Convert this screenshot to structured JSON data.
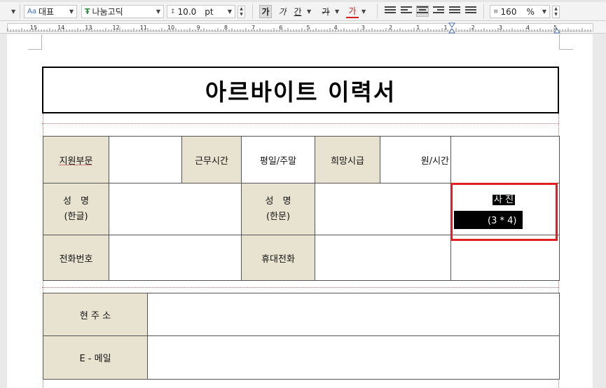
{
  "toolbar": {
    "style": "대표",
    "font": "나눔고딕",
    "size": "10.0",
    "size_unit": "pt",
    "bold": "가",
    "italic": "가",
    "underline": "간",
    "strike": "가",
    "color": "가",
    "line_spacing": "160",
    "line_spacing_unit": "%"
  },
  "ruler": {
    "labels": [
      "15",
      "14",
      "13",
      "12",
      "11",
      "10",
      "9",
      "8",
      "7",
      "6",
      "5",
      "4",
      "3",
      "2",
      "1",
      "1",
      "2",
      "3",
      "4",
      "5"
    ]
  },
  "document": {
    "title": "아르바이트 이력서",
    "row1": {
      "dept_label": "지원부문",
      "dept_value": "",
      "hours_label": "근무시간",
      "hours_value": "평일/주말",
      "wage_label": "희망시급",
      "wage_unit": "원/시간"
    },
    "row2": {
      "name_kr_label_1": "성　명",
      "name_kr_label_2": "(한글)",
      "name_kr_value": "",
      "name_hanja_label_1": "성　명",
      "name_hanja_label_2": "(한문)",
      "name_hanja_value": ""
    },
    "photo": {
      "line1": "사 진",
      "line2": "(3 * 4)"
    },
    "row3": {
      "phone_label": "전화번호",
      "phone_value": "",
      "mobile_label": "휴대전화",
      "mobile_value": ""
    },
    "address_label": "현 주 소",
    "address_value": "",
    "email_label": "E - 메일",
    "email_value": ""
  }
}
